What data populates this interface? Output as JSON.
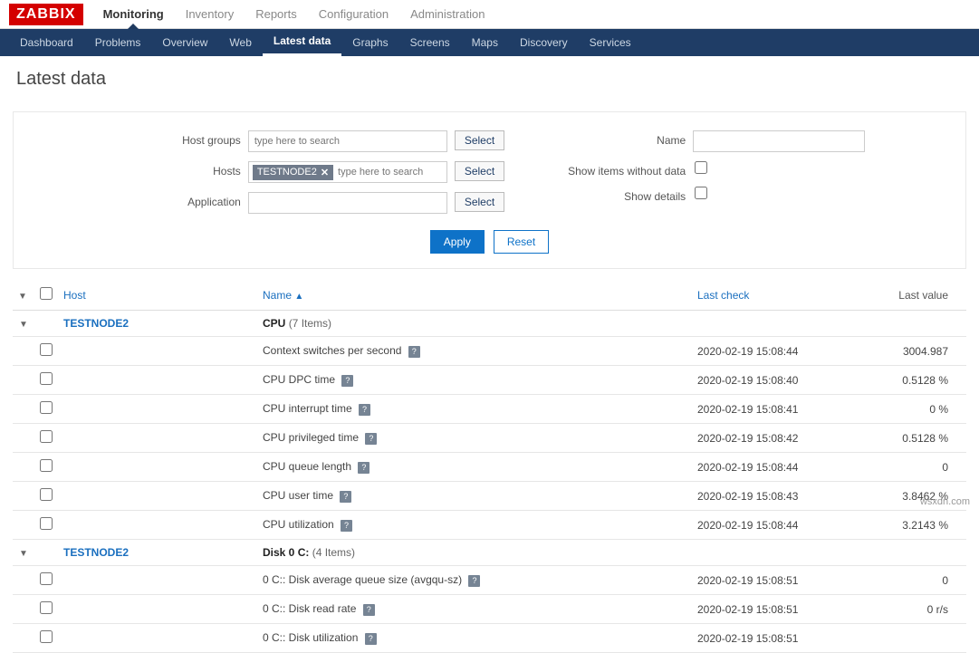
{
  "logo": "ZABBIX",
  "topMenu": {
    "items": [
      "Monitoring",
      "Inventory",
      "Reports",
      "Configuration",
      "Administration"
    ],
    "activeIndex": 0
  },
  "subMenu": {
    "items": [
      "Dashboard",
      "Problems",
      "Overview",
      "Web",
      "Latest data",
      "Graphs",
      "Screens",
      "Maps",
      "Discovery",
      "Services"
    ],
    "activeIndex": 4
  },
  "page": {
    "title": "Latest data"
  },
  "filter": {
    "labels": {
      "hostGroups": "Host groups",
      "hosts": "Hosts",
      "application": "Application",
      "name": "Name",
      "showWithoutData": "Show items without data",
      "showDetails": "Show details"
    },
    "placeholders": {
      "search": "type here to search"
    },
    "hostsTags": [
      "TESTNODE2"
    ],
    "buttons": {
      "select": "Select",
      "apply": "Apply",
      "reset": "Reset"
    }
  },
  "table": {
    "headers": {
      "host": "Host",
      "name": "Name",
      "lastCheck": "Last check",
      "lastValue": "Last value"
    },
    "info_badge": "?",
    "groups": [
      {
        "host": "TESTNODE2",
        "groupName": "CPU",
        "groupCount": "(7 Items)",
        "rows": [
          {
            "name": "Context switches per second",
            "lastCheck": "2020-02-19 15:08:44",
            "lastValue": "3004.987"
          },
          {
            "name": "CPU DPC time",
            "lastCheck": "2020-02-19 15:08:40",
            "lastValue": "0.5128 %"
          },
          {
            "name": "CPU interrupt time",
            "lastCheck": "2020-02-19 15:08:41",
            "lastValue": "0 %"
          },
          {
            "name": "CPU privileged time",
            "lastCheck": "2020-02-19 15:08:42",
            "lastValue": "0.5128 %"
          },
          {
            "name": "CPU queue length",
            "lastCheck": "2020-02-19 15:08:44",
            "lastValue": "0"
          },
          {
            "name": "CPU user time",
            "lastCheck": "2020-02-19 15:08:43",
            "lastValue": "3.8462 %"
          },
          {
            "name": "CPU utilization",
            "lastCheck": "2020-02-19 15:08:44",
            "lastValue": "3.2143 %"
          }
        ]
      },
      {
        "host": "TESTNODE2",
        "groupName": "Disk 0 C:",
        "groupCount": "(4 Items)",
        "rows": [
          {
            "name": "0 C:: Disk average queue size (avgqu-sz)",
            "lastCheck": "2020-02-19 15:08:51",
            "lastValue": "0"
          },
          {
            "name": "0 C:: Disk read rate",
            "lastCheck": "2020-02-19 15:08:51",
            "lastValue": "0 r/s"
          },
          {
            "name": "0 C:: Disk utilization",
            "lastCheck": "2020-02-19 15:08:51",
            "lastValue": ""
          }
        ]
      }
    ]
  },
  "watermark": "wsxdn.com"
}
